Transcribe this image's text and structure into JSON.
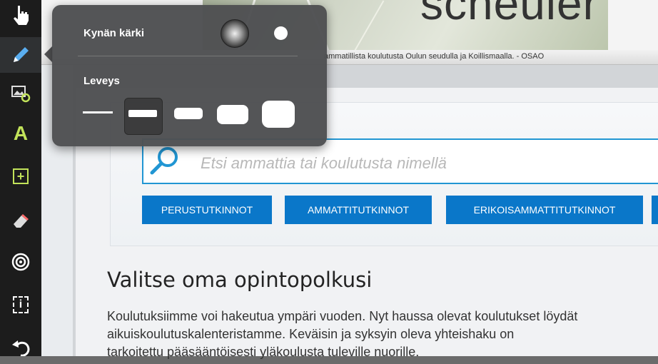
{
  "toolbar": {
    "tools": [
      {
        "name": "hand-tool",
        "icon": "hand-pointer-icon"
      },
      {
        "name": "pen-tool",
        "icon": "pencil-icon",
        "active": true
      },
      {
        "name": "image-tool",
        "icon": "image-add-icon"
      },
      {
        "name": "text-tool",
        "icon": "text-a-icon",
        "glyph": "A"
      },
      {
        "name": "add-box-tool",
        "icon": "plus-box-icon",
        "glyph": "+"
      },
      {
        "name": "eraser-tool",
        "icon": "eraser-icon"
      },
      {
        "name": "target-tool",
        "icon": "target-icon"
      },
      {
        "name": "select-tool",
        "icon": "dashed-select-icon",
        "glyph": "i"
      },
      {
        "name": "undo-tool",
        "icon": "undo-icon"
      }
    ]
  },
  "background": {
    "photo_text": "scheuler",
    "title_text": "ammatillista koulutusta Oulun seudulla ja Koillismaalla. - OSAO",
    "search_placeholder": "Etsi ammattia tai koulutusta nimellä",
    "buttons": [
      "PERUSTUTKINNOT",
      "AMMATTITUTKINNOT",
      "ERIKOISAMMATTITUTKINNOT"
    ],
    "heading": "Valitse oma opintopolkusi",
    "body_lines": [
      "Koulutuksiimme voi hakeutua ympäri vuoden. Nyt haussa olevat koulutukset löydät",
      "aikuiskoulutuskalenteristamme. Keväisin ja syksyin oleva yhteishaku on",
      "tarkoitettu pääsääntöisesti yläkoulusta tuleville nuorille."
    ]
  },
  "popover": {
    "tip_label": "Kynän kärki",
    "width_label": "Leveys",
    "tip_options": [
      "soft-brush",
      "hard-dot"
    ],
    "tip_selected": "soft-brush",
    "width_options": [
      "width-1",
      "width-2",
      "width-3",
      "width-4",
      "width-5"
    ],
    "width_selected": "width-2"
  },
  "colors": {
    "accent": "#0a77c9",
    "highlight": "#c2e35a"
  }
}
